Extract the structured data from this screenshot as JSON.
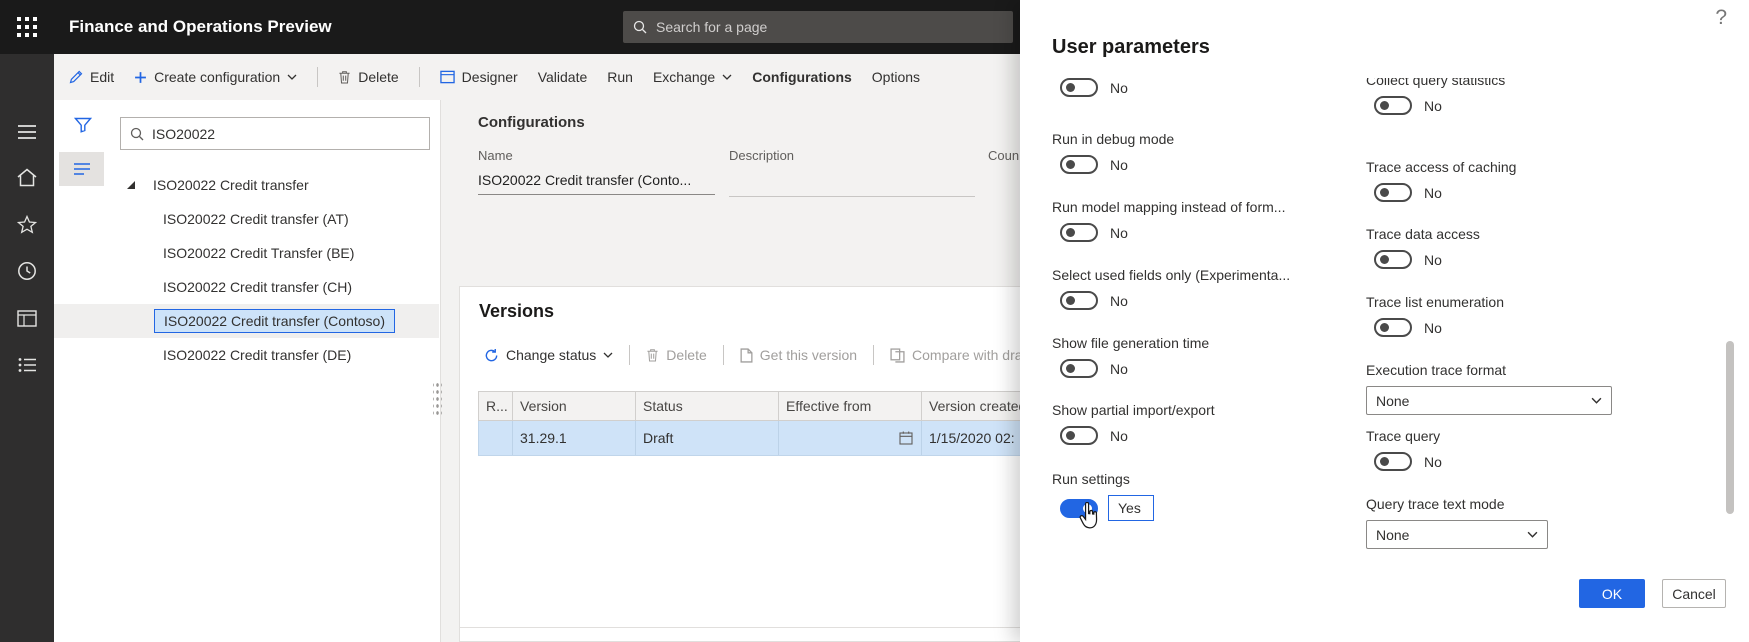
{
  "colors": {
    "accent": "#2266E3",
    "topbar": "#1a1a1a",
    "selected_row": "#cfe3f8",
    "tree_selection_fill": "#cde3f9"
  },
  "icons": {
    "app-launcher-icon": "3x3 dot grid",
    "search-icon": "magnifier",
    "hamburger-menu-icon": "three lines",
    "home-icon": "house",
    "favorites-icon": "star",
    "recent-icon": "clock",
    "workspace-icon": "window grid",
    "checklist-icon": "bulleted list",
    "filter-icon": "funnel",
    "list-view-icon": "horizontal lines",
    "edit-icon": "pencil",
    "add-icon": "plus",
    "delete-icon": "trash can",
    "designer-icon": "window",
    "chevron-down-icon": "chevron",
    "change-status-icon": "circular refresh arrows",
    "get-version-icon": "document",
    "compare-icon": "two documents",
    "calendar-icon": "calendar",
    "expand-triangle-icon": "filled triangle",
    "help-icon": "question mark",
    "mouse-cursor-icon": "hand pointer"
  },
  "topbar": {
    "title": "Finance and Operations Preview",
    "search_placeholder": "Search for a page"
  },
  "action_bar": {
    "items": [
      {
        "label": "Edit"
      },
      {
        "label": "Create configuration"
      },
      {
        "label": "Delete"
      },
      {
        "label": "Designer"
      },
      {
        "label": "Validate"
      },
      {
        "label": "Run"
      },
      {
        "label": "Exchange"
      },
      {
        "label": "Configurations"
      },
      {
        "label": "Options"
      }
    ]
  },
  "left_panel": {
    "search_value": "ISO20022",
    "tree_root": "ISO20022 Credit transfer",
    "tree_items": [
      "ISO20022 Credit transfer (AT)",
      "ISO20022 Credit Transfer (BE)",
      "ISO20022 Credit transfer (CH)",
      "ISO20022 Credit transfer (Contoso)",
      "ISO20022 Credit transfer (DE)"
    ],
    "selected_item": "ISO20022 Credit transfer (Contoso)"
  },
  "content": {
    "section_title": "Configurations",
    "name_label": "Name",
    "name_value": "ISO20022 Credit transfer (Conto...",
    "description_label": "Description",
    "country_label": "Coun",
    "versions": {
      "title": "Versions",
      "toolbar": {
        "change_status": "Change status",
        "delete": "Delete",
        "get_this_version": "Get this version",
        "compare": "Compare with dra"
      },
      "columns": [
        "R...",
        "Version",
        "Status",
        "Effective from",
        "Version created"
      ],
      "row": {
        "version": "31.29.1",
        "status": "Draft",
        "effective_from": "",
        "version_created": "1/15/2020 02:"
      }
    }
  },
  "flyout": {
    "title": "User parameters",
    "left": [
      {
        "label": "",
        "value": "No"
      },
      {
        "label": "Run in debug mode",
        "value": "No"
      },
      {
        "label": "Run model mapping instead of form...",
        "value": "No"
      },
      {
        "label": "Select used fields only (Experimenta...",
        "value": "No"
      },
      {
        "label": "Show file generation time",
        "value": "No"
      },
      {
        "label": "Show partial import/export",
        "value": "No"
      },
      {
        "label": "Run settings",
        "value": "Yes"
      }
    ],
    "right": [
      {
        "label": "Collect query statistics",
        "value": "No"
      },
      {
        "label": "Trace access of caching",
        "value": "No"
      },
      {
        "label": "Trace data access",
        "value": "No"
      },
      {
        "label": "Trace list enumeration",
        "value": "No"
      },
      {
        "label": "Execution trace format",
        "value": "None"
      },
      {
        "label": "Trace query",
        "value": "No"
      },
      {
        "label": "Query trace text mode",
        "value": "None"
      }
    ],
    "ok_label": "OK",
    "cancel_label": "Cancel"
  }
}
